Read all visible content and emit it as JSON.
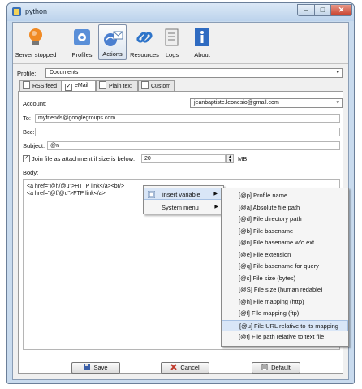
{
  "window": {
    "title": "python"
  },
  "toolbar": {
    "items": [
      {
        "label": "Server stopped",
        "icon": "lightbulb-icon"
      },
      {
        "label": "Profiles",
        "icon": "gear-icon"
      },
      {
        "label": "Actions",
        "icon": "actions-icon"
      },
      {
        "label": "Resources",
        "icon": "link-icon"
      },
      {
        "label": "Logs",
        "icon": "logs-icon"
      },
      {
        "label": "About",
        "icon": "info-icon"
      }
    ]
  },
  "profile": {
    "label": "Profile:",
    "value": "Documents"
  },
  "tabs": [
    {
      "label": "RSS feed",
      "checked": false
    },
    {
      "label": "eMail",
      "checked": true
    },
    {
      "label": "Plain text",
      "checked": false
    },
    {
      "label": "Custom",
      "checked": false
    }
  ],
  "form": {
    "account_label": "Account:",
    "account_value": "jeanbaptiste.leonesio@gmail.com",
    "to_label": "To:",
    "to_value": "myfriends@googlegroups.com",
    "bcc_label": "Bcc:",
    "bcc_value": "",
    "subject_label": "Subject:",
    "subject_value": "@n",
    "attach_label": "Join file as attachment if size is below:",
    "attach_checked": true,
    "attach_size": "20",
    "attach_unit": "MB",
    "body_label": "Body:",
    "body_lines": [
      "<a href=\"@h/@u\">HTTP link</a><br/>",
      "<a href=\"@f/@u\">FTP link</a>"
    ]
  },
  "context_menu": {
    "items": [
      {
        "label": "insert variable"
      },
      {
        "label": "System menu"
      }
    ]
  },
  "variables": [
    "[@p] Profile name",
    "[@a] Absolute file path",
    "[@d] File directory path",
    "[@b] File basename",
    "[@n] File basename w/o ext",
    "[@e] File extension",
    "[@q] File basename for query",
    "[@s] File size (bytes)",
    "[@S] File size (human redable)",
    "[@h] File mapping (http)",
    "[@f] File mapping (ftp)",
    "[@u] File URL relative to its mapping",
    "[@t] File path relative to text file"
  ],
  "buttons": {
    "save": "Save",
    "cancel": "Cancel",
    "default": "Default"
  },
  "colors": {
    "accent": "#3a6fb5",
    "highlight": "#d9e6f7"
  }
}
